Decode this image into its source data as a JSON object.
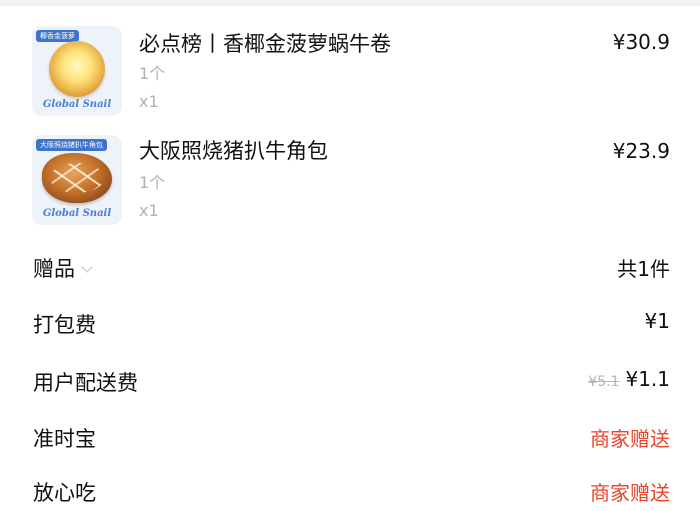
{
  "items": [
    {
      "name": "必点榜丨香椰金菠萝蜗牛卷",
      "spec": "1个",
      "quantity": "x1",
      "price": "¥30.9",
      "thumb_label": "椰香金菠萝",
      "thumb_brand": "Global Snail"
    },
    {
      "name": "大阪照烧猪扒牛角包",
      "spec": "1个",
      "quantity": "x1",
      "price": "¥23.9",
      "thumb_label": "大阪照烧猪扒牛角包",
      "thumb_brand": "Global Snail"
    }
  ],
  "summary": {
    "gift": {
      "label": "赠品",
      "value": "共1件"
    },
    "packing_fee": {
      "label": "打包费",
      "value": "¥1"
    },
    "delivery_fee": {
      "label": "用户配送费",
      "original": "¥5.1",
      "value": "¥1.1"
    },
    "on_time": {
      "label": "准时宝",
      "value": "商家赠送"
    },
    "safe_eat": {
      "label": "放心吃",
      "value": "商家赠送"
    }
  },
  "colors": {
    "accent_red": "#e8442c",
    "muted_gray": "#b0b0b0"
  }
}
